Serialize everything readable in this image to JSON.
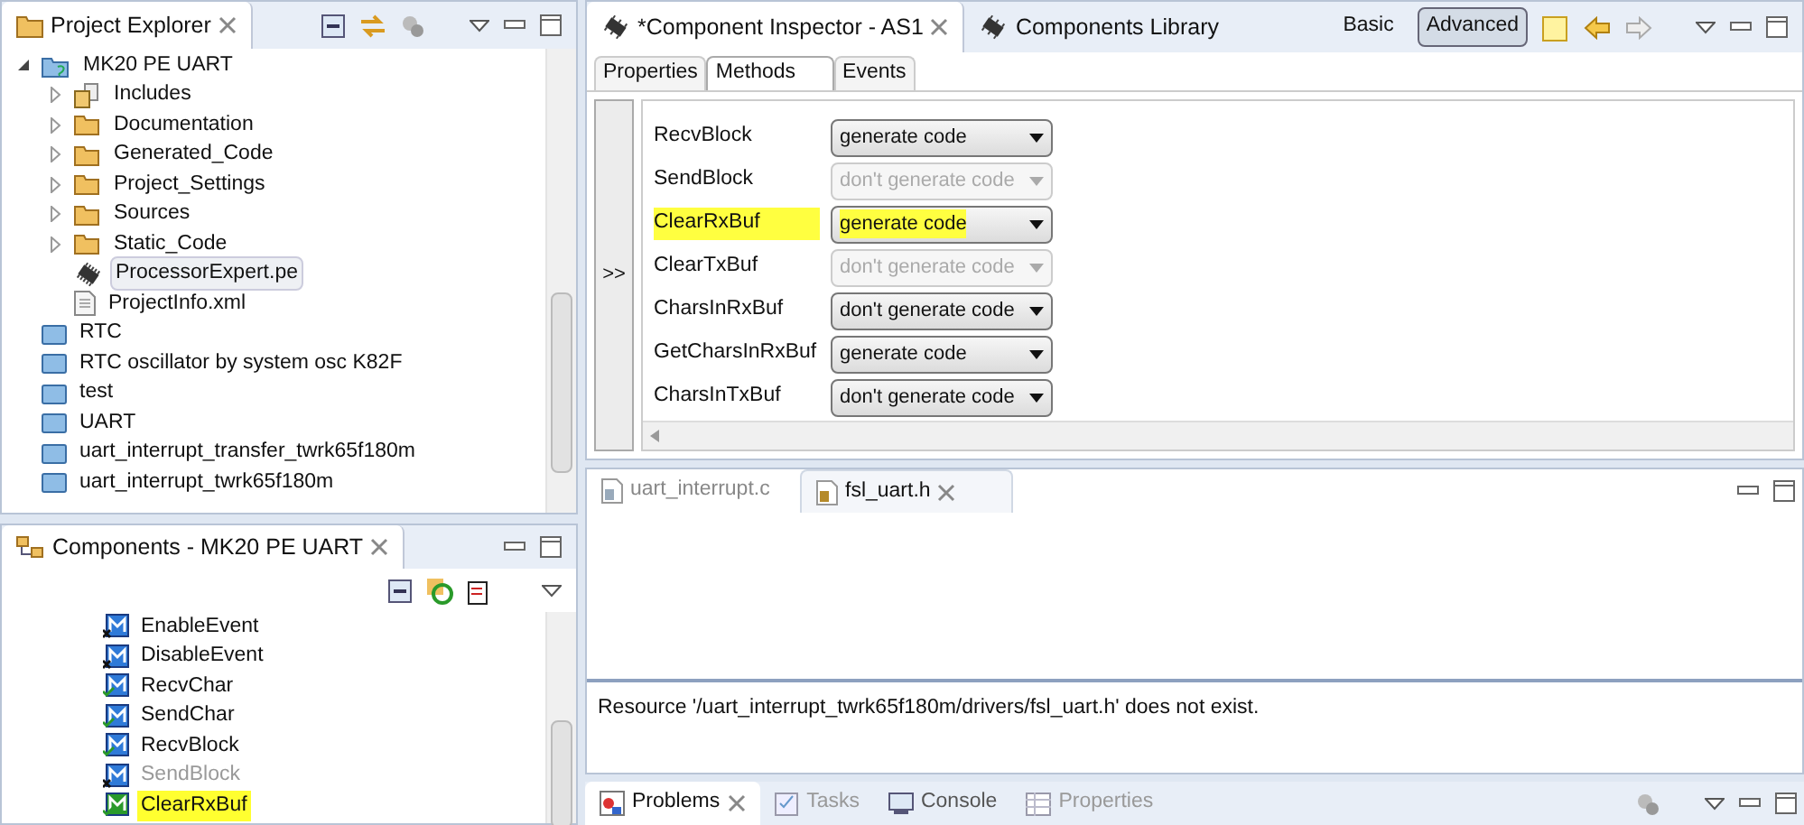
{
  "project_explorer": {
    "title": "Project Explorer",
    "tree": [
      {
        "label": "MK20 PE UART",
        "kind": "project",
        "expanded": true,
        "children": [
          {
            "label": "Includes",
            "kind": "includes",
            "expanded": false
          },
          {
            "label": "Documentation",
            "kind": "folder",
            "expanded": false
          },
          {
            "label": "Generated_Code",
            "kind": "folder",
            "expanded": false
          },
          {
            "label": "Project_Settings",
            "kind": "folder",
            "expanded": false
          },
          {
            "label": "Sources",
            "kind": "folder",
            "expanded": false
          },
          {
            "label": "Static_Code",
            "kind": "folder",
            "expanded": false
          },
          {
            "label": "ProcessorExpert.pe",
            "kind": "chip",
            "selected": true
          },
          {
            "label": "ProjectInfo.xml",
            "kind": "file",
            "selected": false
          }
        ]
      },
      {
        "label": "RTC",
        "kind": "closed-project"
      },
      {
        "label": "RTC oscillator by system osc K82F",
        "kind": "closed-project"
      },
      {
        "label": "test",
        "kind": "closed-project"
      },
      {
        "label": "UART",
        "kind": "closed-project"
      },
      {
        "label": "uart_interrupt_transfer_twrk65f180m",
        "kind": "closed-project"
      },
      {
        "label": "uart_interrupt_twrk65f180m",
        "kind": "closed-project"
      }
    ]
  },
  "components": {
    "title": "Components - MK20 PE UART",
    "items": [
      {
        "name": "EnableEvent",
        "enabled": false,
        "selected": false
      },
      {
        "name": "DisableEvent",
        "enabled": false,
        "selected": false
      },
      {
        "name": "RecvChar",
        "enabled": true,
        "selected": false
      },
      {
        "name": "SendChar",
        "enabled": true,
        "selected": false
      },
      {
        "name": "RecvBlock",
        "enabled": true,
        "selected": false
      },
      {
        "name": "SendBlock",
        "enabled": false,
        "greyed": true,
        "selected": false
      },
      {
        "name": "ClearRxBuf",
        "enabled": true,
        "selected": true
      }
    ]
  },
  "inspector": {
    "tabs": [
      {
        "label": "*Component Inspector - AS1",
        "selected": true,
        "closable": true
      },
      {
        "label": "Components Library",
        "selected": false,
        "closable": false
      }
    ],
    "modes": [
      {
        "label": "Basic",
        "selected": false
      },
      {
        "label": "Advanced",
        "selected": true
      }
    ],
    "subtabs": [
      {
        "label": "Properties",
        "selected": false
      },
      {
        "label": "Methods",
        "selected": true
      },
      {
        "label": "Events",
        "selected": false
      }
    ],
    "expand_button": ">>",
    "methods": [
      {
        "name": "RecvBlock",
        "value": "generate code",
        "disabled": false,
        "highlighted": false
      },
      {
        "name": "SendBlock",
        "value": "don't generate code",
        "disabled": true,
        "highlighted": false
      },
      {
        "name": "ClearRxBuf",
        "value": "generate code",
        "disabled": false,
        "highlighted": true
      },
      {
        "name": "ClearTxBuf",
        "value": "don't generate code",
        "disabled": true,
        "highlighted": false
      },
      {
        "name": "CharsInRxBuf",
        "value": "don't generate code",
        "disabled": false,
        "highlighted": false
      },
      {
        "name": "GetCharsInRxBuf",
        "value": "generate code",
        "disabled": false,
        "highlighted": false
      },
      {
        "name": "CharsInTxBuf",
        "value": "don't generate code",
        "disabled": false,
        "highlighted": false
      }
    ]
  },
  "editor": {
    "tabs": [
      {
        "label": "uart_interrupt.c",
        "kind": "c",
        "selected": false
      },
      {
        "label": "fsl_uart.h",
        "kind": "h",
        "selected": true
      }
    ],
    "message": "Resource '/uart_interrupt_twrk65f180m/drivers/fsl_uart.h' does not exist."
  },
  "bottom_tabs": [
    {
      "label": "Problems",
      "kind": "problems",
      "selected": true,
      "disabled": false
    },
    {
      "label": "Tasks",
      "kind": "tasks",
      "selected": false,
      "disabled": true
    },
    {
      "label": "Console",
      "kind": "console",
      "selected": false,
      "disabled": false
    },
    {
      "label": "Properties",
      "kind": "properties",
      "selected": false,
      "disabled": true
    }
  ]
}
